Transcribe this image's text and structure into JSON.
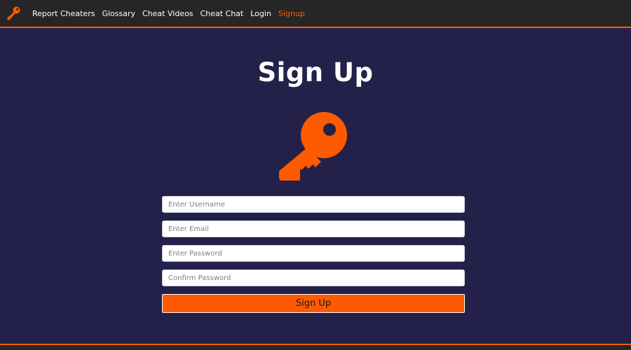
{
  "nav": {
    "brand_icon": "microphone-logo-icon",
    "items": [
      {
        "label": "Report Cheaters",
        "active": false
      },
      {
        "label": "Glossary",
        "active": false
      },
      {
        "label": "Cheat Videos",
        "active": false
      },
      {
        "label": "Cheat Chat",
        "active": false
      },
      {
        "label": "Login",
        "active": false
      },
      {
        "label": "Signup",
        "active": true
      }
    ]
  },
  "page": {
    "title": "Sign Up",
    "hero_icon": "key-icon"
  },
  "form": {
    "username_placeholder": "Enter Username",
    "email_placeholder": "Enter Email",
    "password_placeholder": "Enter Password",
    "confirm_placeholder": "Confirm Password",
    "submit_label": "Sign Up"
  },
  "colors": {
    "accent": "#ff5a00",
    "background": "#23214a",
    "navbar": "#262626"
  }
}
